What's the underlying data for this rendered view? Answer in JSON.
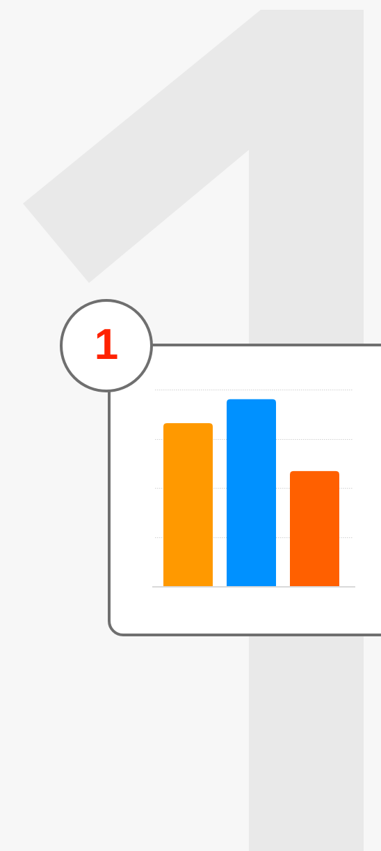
{
  "step": {
    "number": "1",
    "number_color": "#ff2200"
  },
  "colors": {
    "background": "#f7f7f7",
    "numeral_shape": "#e9e9e9",
    "card_border": "#6f6f6f",
    "gridline": "#d0d0d0",
    "baseline": "#d9d9d9"
  },
  "chart_data": {
    "type": "bar",
    "categories": [
      "",
      "",
      ""
    ],
    "values": [
      68,
      78,
      48
    ],
    "colors": [
      "#ff9900",
      "#0091ff",
      "#ff6000"
    ],
    "ylim": [
      0,
      82
    ],
    "grid": true,
    "legend": "none"
  }
}
